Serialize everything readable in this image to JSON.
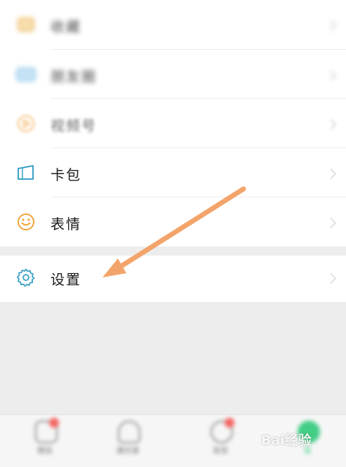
{
  "menu": {
    "items": [
      {
        "label": "收藏",
        "icon": "favorites-icon"
      },
      {
        "label": "朋友圈",
        "icon": "moments-icon"
      },
      {
        "label": "视频号",
        "icon": "channels-icon"
      },
      {
        "label": "卡包",
        "icon": "card-wallet-icon"
      },
      {
        "label": "表情",
        "icon": "stickers-icon"
      }
    ],
    "settings": {
      "label": "设置",
      "icon": "gear-icon"
    }
  },
  "tabbar": {
    "tabs": [
      {
        "label": "微信",
        "icon": "chat-icon",
        "badge": true
      },
      {
        "label": "通讯录",
        "icon": "contacts-icon",
        "badge": false
      },
      {
        "label": "发现",
        "icon": "discover-icon",
        "badge": true
      },
      {
        "label": "我",
        "icon": "me-icon",
        "badge": false,
        "active": true
      }
    ]
  },
  "watermark": "Bai经验",
  "colors": {
    "accent_arrow": "#f3a46a",
    "icon_teal": "#3aa0c8",
    "icon_orange": "#f0a33a",
    "wechat_green": "#07c160"
  }
}
